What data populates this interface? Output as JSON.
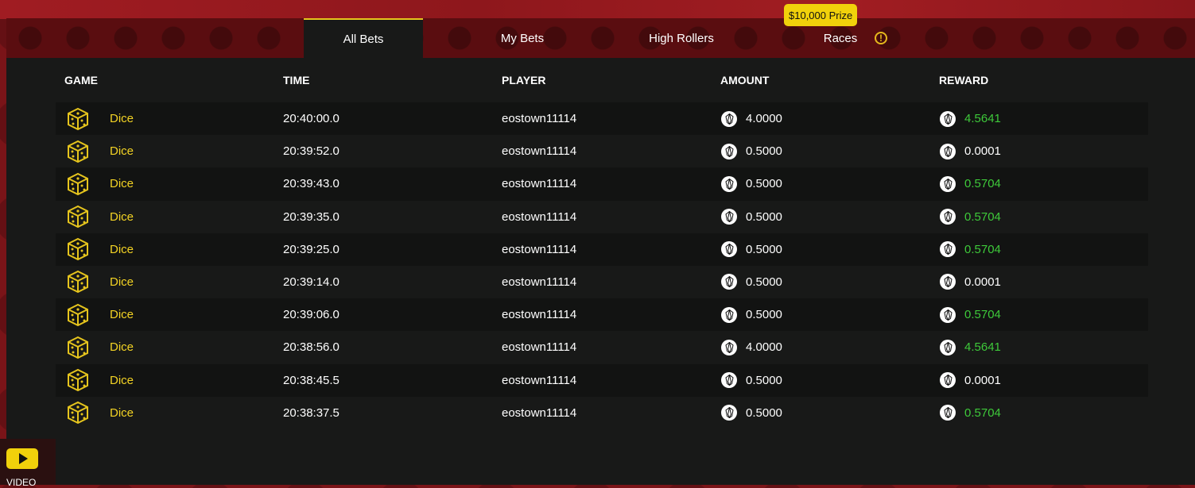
{
  "tabs": [
    {
      "label": "All Bets",
      "active": true
    },
    {
      "label": "My Bets",
      "active": false
    },
    {
      "label": "High Rollers",
      "active": false
    },
    {
      "label": "Races",
      "active": false
    }
  ],
  "prize_badge": "$10,000 Prize",
  "warning_glyph": "!",
  "columns": [
    "GAME",
    "TIME",
    "PLAYER",
    "AMOUNT",
    "REWARD"
  ],
  "bets": [
    {
      "game": "Dice",
      "time": "20:40:00.0",
      "player": "eostown11114",
      "amount": "4.0000",
      "reward": "4.5641",
      "win": true
    },
    {
      "game": "Dice",
      "time": "20:39:52.0",
      "player": "eostown11114",
      "amount": "0.5000",
      "reward": "0.0001",
      "win": false
    },
    {
      "game": "Dice",
      "time": "20:39:43.0",
      "player": "eostown11114",
      "amount": "0.5000",
      "reward": "0.5704",
      "win": true
    },
    {
      "game": "Dice",
      "time": "20:39:35.0",
      "player": "eostown11114",
      "amount": "0.5000",
      "reward": "0.5704",
      "win": true
    },
    {
      "game": "Dice",
      "time": "20:39:25.0",
      "player": "eostown11114",
      "amount": "0.5000",
      "reward": "0.5704",
      "win": true
    },
    {
      "game": "Dice",
      "time": "20:39:14.0",
      "player": "eostown11114",
      "amount": "0.5000",
      "reward": "0.0001",
      "win": false
    },
    {
      "game": "Dice",
      "time": "20:39:06.0",
      "player": "eostown11114",
      "amount": "0.5000",
      "reward": "0.5704",
      "win": true
    },
    {
      "game": "Dice",
      "time": "20:38:56.0",
      "player": "eostown11114",
      "amount": "4.0000",
      "reward": "4.5641",
      "win": true
    },
    {
      "game": "Dice",
      "time": "20:38:45.5",
      "player": "eostown11114",
      "amount": "0.5000",
      "reward": "0.0001",
      "win": false
    },
    {
      "game": "Dice",
      "time": "20:38:37.5",
      "player": "eostown11114",
      "amount": "0.5000",
      "reward": "0.5704",
      "win": true
    }
  ],
  "video_label": "VIDEO",
  "colors": {
    "accent_yellow": "#f3d324",
    "win_green": "#3ec93a",
    "panel_bg": "#181918",
    "tabbar_red": "#5a0d10"
  }
}
